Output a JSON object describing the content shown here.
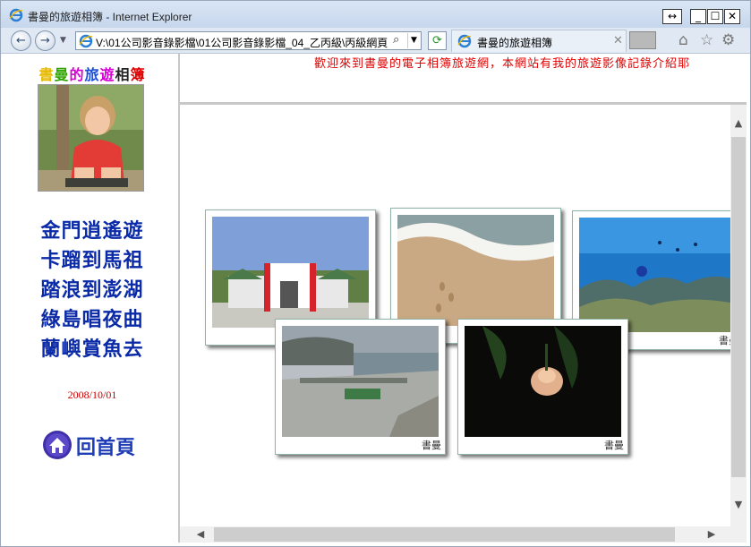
{
  "window": {
    "title": "書曼的旅遊相簿 - Internet Explorer",
    "buttons": {
      "resize": "↔",
      "minimize": "_",
      "maximize": "☐",
      "close": "✕"
    }
  },
  "browser": {
    "address": "V:\\01公司影音錄影檔\\01公司影音錄影檔_04_乙丙級\\丙級網頁",
    "tab_title": "書曼的旅遊相簿",
    "icons": {
      "back": "←",
      "forward": "→",
      "refresh": "⟳",
      "home": "⌂",
      "favorites": "☆",
      "tools": "⚙",
      "search": "⌕",
      "close_tab": "✕"
    }
  },
  "page": {
    "site_title_chars": [
      {
        "ch": "書",
        "color": "#e6b800"
      },
      {
        "ch": "曼",
        "color": "#2da300"
      },
      {
        "ch": "的",
        "color": "#d400d4"
      },
      {
        "ch": "旅",
        "color": "#1a4fd8"
      },
      {
        "ch": "遊",
        "color": "#d400d4"
      },
      {
        "ch": "相",
        "color": "#222222"
      },
      {
        "ch": "簿",
        "color": "#e00000"
      }
    ],
    "marquee": "歡迎來到書曼的電子相簿旅遊網，本網站有我的旅遊影像記錄介紹耶",
    "nav_links": [
      "金門逍遙遊",
      "卡蹓到馬祖",
      "踏浪到澎湖",
      "綠島唱夜曲",
      "蘭嶼賞魚去"
    ],
    "date": "2008/10/01",
    "home_label": "回首頁",
    "photo_signature": "書曼",
    "colors": {
      "nav": "#0a2aa8",
      "marquee": "#e00000",
      "date": "#cc0000",
      "home": "#1f3db5"
    }
  }
}
